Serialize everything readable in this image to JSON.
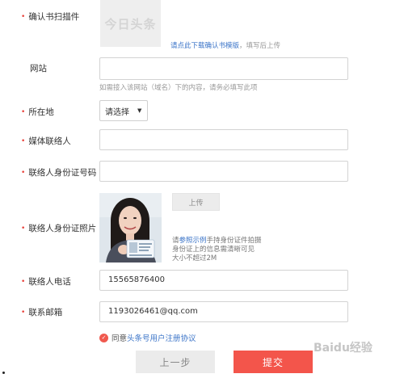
{
  "form": {
    "authorization_scan": {
      "label": "确认书扫描件",
      "placeholder_logo": "今日头条",
      "download_link": "请点此下载确认书模版",
      "download_hint": "，填写后上传"
    },
    "website": {
      "label": "网站",
      "value": "",
      "hint": "如需接入该网站（域名）下的内容，请务必填写此项"
    },
    "location": {
      "label": "所在地",
      "selected": "请选择"
    },
    "media_contact": {
      "label": "媒体联络人",
      "value": ""
    },
    "contact_id_number": {
      "label": "联络人身份证号码",
      "value": ""
    },
    "contact_id_photo": {
      "label": "联络人身份证照片",
      "upload_label": "上传",
      "hint_prefix": "请",
      "hint_link": "参照示例",
      "hint_line1_rest": "手持身份证件拍摄",
      "hint_line2": "身份证上的信息需清晰可见",
      "hint_line3": "大小不超过2M"
    },
    "contact_phone": {
      "label": "联络人电话",
      "value": "15565876400"
    },
    "contact_email": {
      "label": "联系邮箱",
      "value": "1193026461@qq.com"
    },
    "agreement": {
      "prefix": "同意",
      "link": "头条号用户注册协议",
      "checked": true
    },
    "buttons": {
      "prev": "上一步",
      "submit": "提交"
    }
  },
  "watermark": "Baidu经验",
  "colors": {
    "required_mark": "#e8413a",
    "link": "#3b74c8",
    "submit": "#f3554b"
  }
}
